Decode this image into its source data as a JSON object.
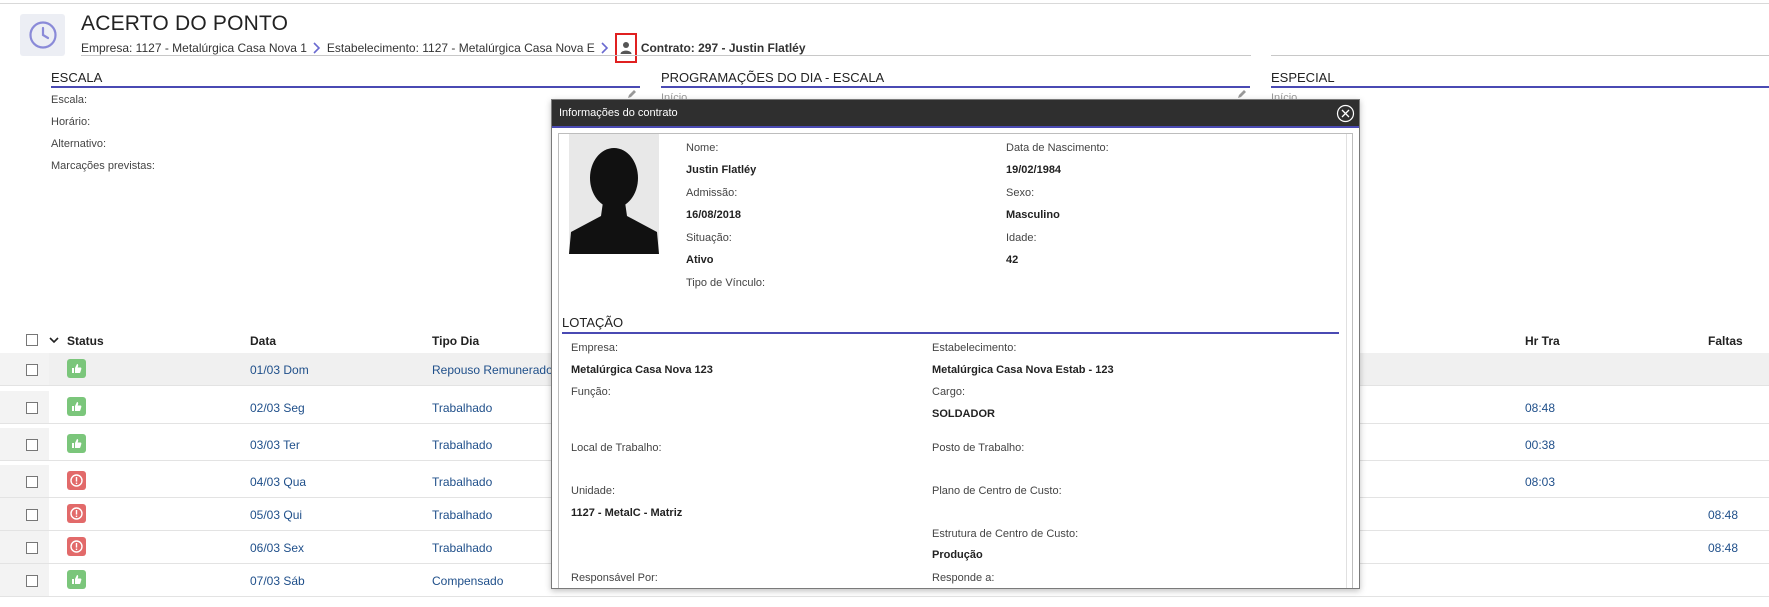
{
  "header": {
    "title": "ACERTO DO PONTO",
    "breadcrumb": {
      "empresa": "Empresa: 1127 - Metalúrgica Casa Nova 1",
      "estabelecimento": "Estabelecimento: 1127 - Metalúrgica Casa Nova E",
      "contrato": "Contrato: 297 - Justin Flatléy"
    }
  },
  "panels": {
    "escala": {
      "title": "ESCALA",
      "fields": [
        "Escala:",
        "Horário:",
        "Alternativo:",
        "Marcações previstas:"
      ]
    },
    "programacoes": {
      "title": "PROGRAMAÇÕES DO DIA - ESCALA",
      "partial": "Início"
    },
    "especial": {
      "title": "ESPECIAL",
      "partial": "Início"
    }
  },
  "grid": {
    "headers": {
      "status": "Status",
      "data": "Data",
      "tipo_dia": "Tipo Dia",
      "hr_tra": "Hr Tra",
      "faltas": "Faltas"
    },
    "rows": [
      {
        "status": "ok",
        "data": "01/03 Dom",
        "tipo": "Repouso Remunerado",
        "hr_tra": "",
        "faltas": ""
      },
      {
        "status": "ok",
        "data": "02/03 Seg",
        "tipo": "Trabalhado",
        "hr_tra": "08:48",
        "faltas": ""
      },
      {
        "status": "ok",
        "data": "03/03 Ter",
        "tipo": "Trabalhado",
        "hr_tra": "00:38",
        "faltas": ""
      },
      {
        "status": "error",
        "data": "04/03 Qua",
        "tipo": "Trabalhado",
        "hr_tra": "08:03",
        "faltas": ""
      },
      {
        "status": "error",
        "data": "05/03 Qui",
        "tipo": "Trabalhado",
        "hr_tra": "",
        "faltas": "08:48"
      },
      {
        "status": "error",
        "data": "06/03 Sex",
        "tipo": "Trabalhado",
        "hr_tra": "",
        "faltas": "08:48"
      },
      {
        "status": "ok",
        "data": "07/03 Sáb",
        "tipo": "Compensado",
        "hr_tra": "",
        "faltas": ""
      }
    ]
  },
  "modal": {
    "title": "Informações do contrato",
    "personal": {
      "nome_label": "Nome:",
      "nome": "Justin Flatléy",
      "nasc_label": "Data de Nascimento:",
      "nasc": "19/02/1984",
      "admissao_label": "Admissão:",
      "admissao": "16/08/2018",
      "sexo_label": "Sexo:",
      "sexo": "Masculino",
      "situacao_label": "Situação:",
      "situacao": "Ativo",
      "idade_label": "Idade:",
      "idade": "42",
      "vinculo_label": "Tipo de Vínculo:"
    },
    "lotacao": {
      "title": "LOTAÇÃO",
      "empresa_label": "Empresa:",
      "empresa": "Metalúrgica Casa Nova 123",
      "estab_label": "Estabelecimento:",
      "estab": "Metalúrgica Casa Nova Estab - 123",
      "funcao_label": "Função:",
      "cargo_label": "Cargo:",
      "cargo": "SOLDADOR",
      "local_label": "Local de Trabalho:",
      "posto_label": "Posto de Trabalho:",
      "unidade_label": "Unidade:",
      "unidade": "1127 - MetalC - Matriz",
      "plano_label": "Plano de Centro de Custo:",
      "estrutura_label": "Estrutura de Centro de Custo:",
      "estrutura": "Produção",
      "responsavel_label": "Responsável Por:",
      "responde_label": "Responde a:"
    }
  },
  "colors": {
    "accent": "#4a4ab3",
    "ok": "#7bc67b",
    "error": "#e26a6a",
    "link": "#1f4f8a"
  }
}
